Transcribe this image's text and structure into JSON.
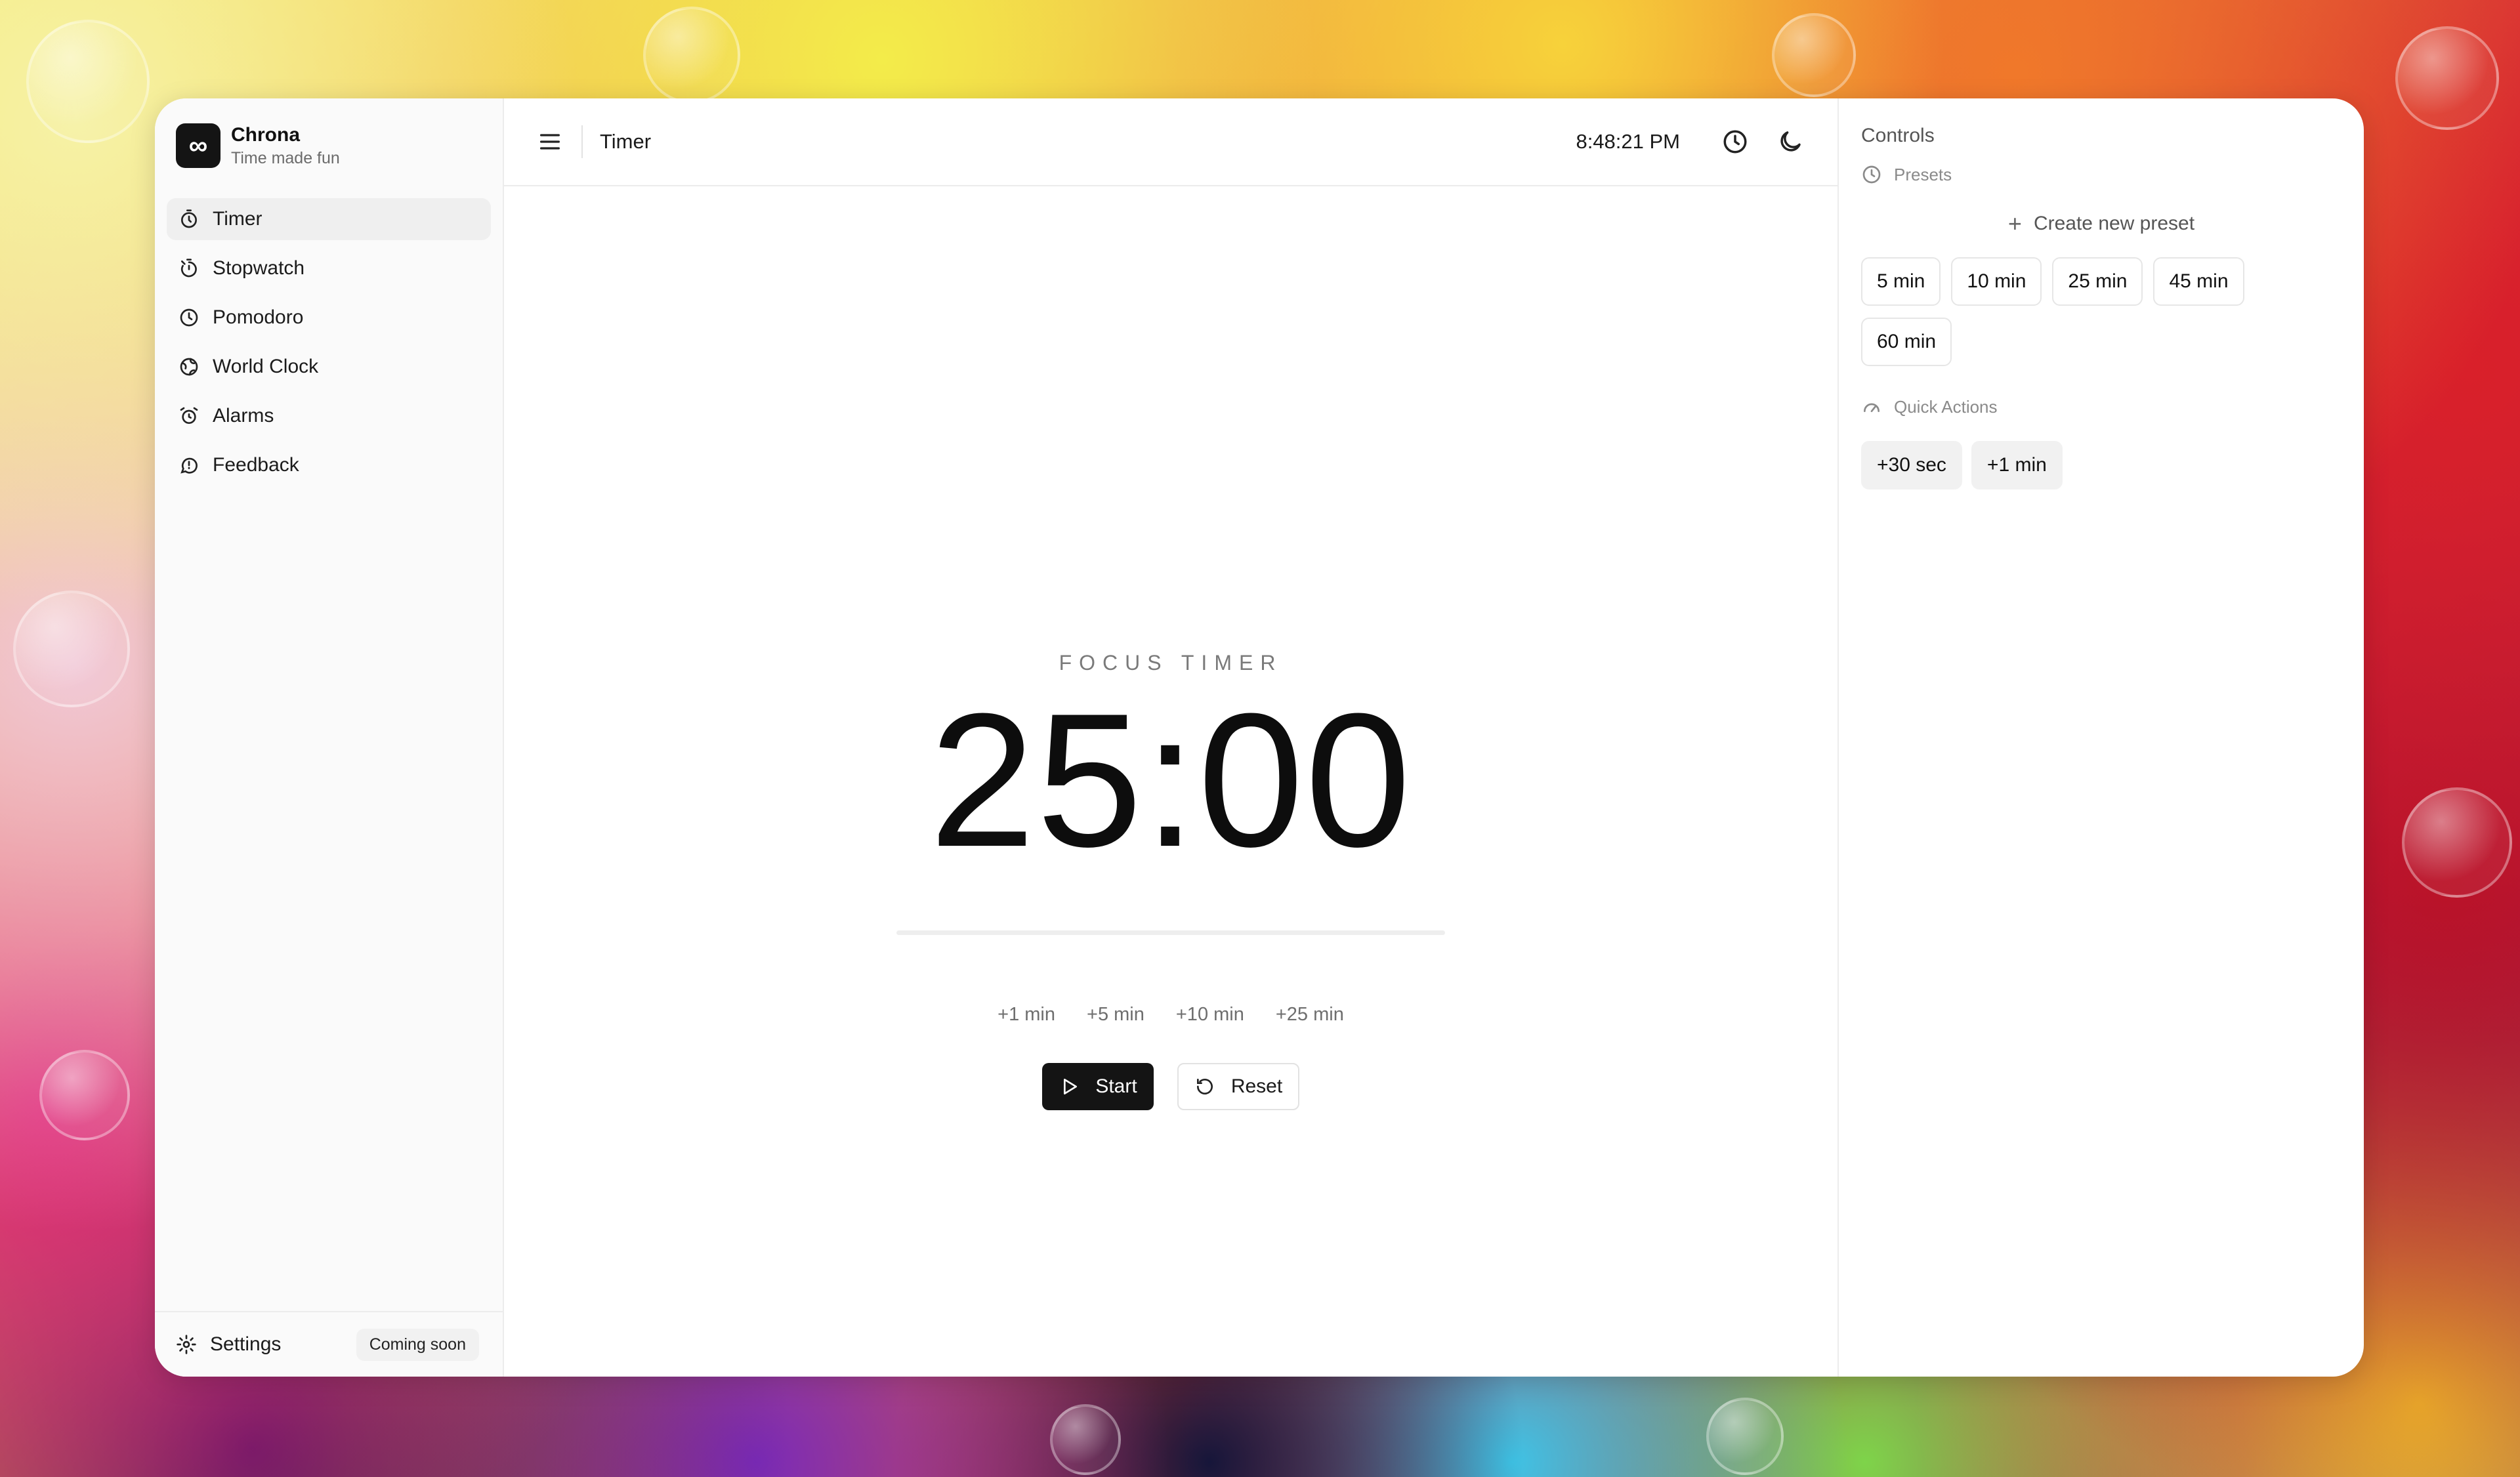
{
  "brand": {
    "name": "Chrona",
    "tagline": "Time made fun",
    "logo_icon": "infinity-icon"
  },
  "sidebar": {
    "items": [
      {
        "label": "Timer",
        "icon": "timer-icon",
        "active": true
      },
      {
        "label": "Stopwatch",
        "icon": "stopwatch-icon",
        "active": false
      },
      {
        "label": "Pomodoro",
        "icon": "clock-icon",
        "active": false
      },
      {
        "label": "World Clock",
        "icon": "globe-icon",
        "active": false
      },
      {
        "label": "Alarms",
        "icon": "alarm-icon",
        "active": false
      },
      {
        "label": "Feedback",
        "icon": "feedback-icon",
        "active": false
      }
    ],
    "settings": {
      "label": "Settings",
      "badge": "Coming soon",
      "icon": "gear-icon"
    }
  },
  "topbar": {
    "title": "Timer",
    "time": "8:48:21 PM",
    "icons": [
      "menu-icon",
      "clock-icon",
      "moon-icon"
    ]
  },
  "timer": {
    "label": "FOCUS TIMER",
    "display": "25:00",
    "progress": 0,
    "increments": [
      "+1 min",
      "+5 min",
      "+10 min",
      "+25 min"
    ],
    "start_label": "Start",
    "reset_label": "Reset"
  },
  "controls": {
    "title": "Controls",
    "presets": {
      "header": "Presets",
      "create_label": "Create new preset",
      "items": [
        "5 min",
        "10 min",
        "25 min",
        "45 min",
        "60 min"
      ]
    },
    "quick_actions": {
      "header": "Quick Actions",
      "items": [
        "+30 sec",
        "+1 min"
      ]
    }
  },
  "colors": {
    "accent": "#141414",
    "active_nav_bg": "#efefef"
  }
}
